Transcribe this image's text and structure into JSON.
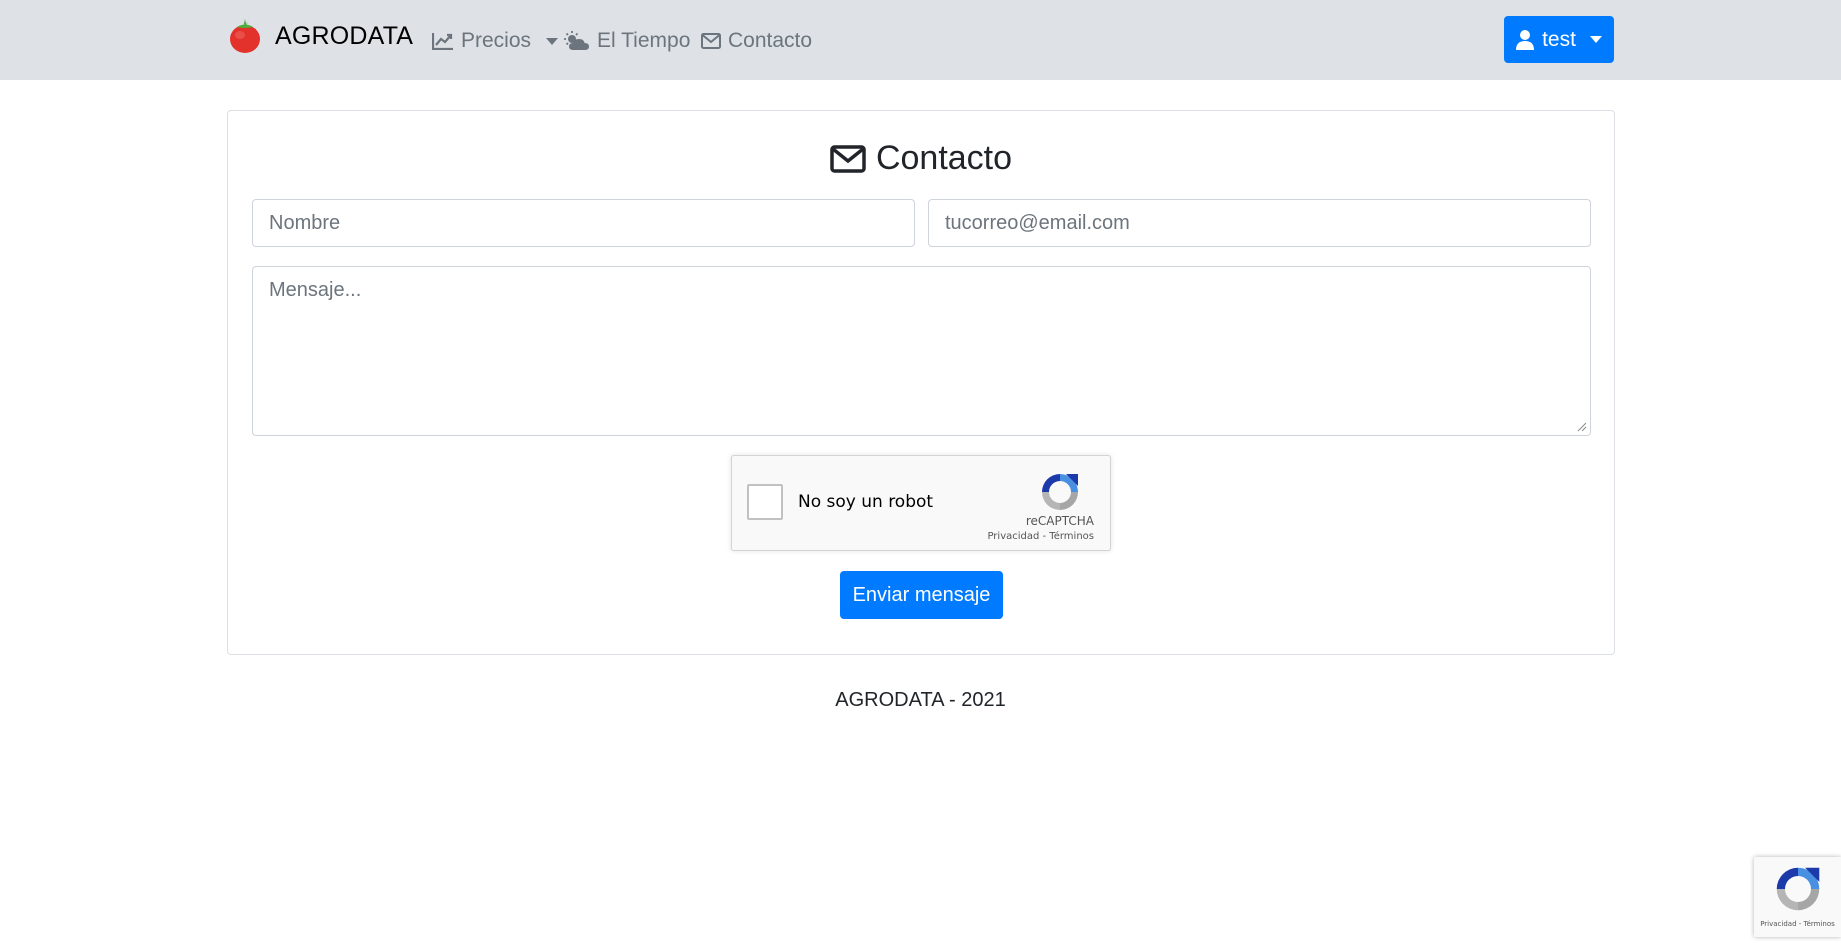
{
  "navbar": {
    "brand": "AGRODATA",
    "items": [
      {
        "label": "Precios",
        "icon": "chart-line-icon",
        "dropdown": true
      },
      {
        "label": "El Tiempo",
        "icon": "cloud-sun-icon",
        "dropdown": false
      },
      {
        "label": "Contacto",
        "icon": "envelope-icon",
        "dropdown": false
      }
    ],
    "user": {
      "label": "test",
      "icon": "user-icon"
    }
  },
  "contact": {
    "title": "Contacto",
    "name_placeholder": "Nombre",
    "email_placeholder": "tucorreo@email.com",
    "message_placeholder": "Mensaje...",
    "submit_label": "Enviar mensaje"
  },
  "recaptcha": {
    "label": "No soy un robot",
    "brand": "reCAPTCHA",
    "links": "Privacidad - Términos",
    "badge_links": "Privacidad - Términos"
  },
  "footer": {
    "text": "AGRODATA - 2021"
  },
  "colors": {
    "primary": "#007bff",
    "navbar_bg": "#dee2e6",
    "nav_text": "#6c757d"
  }
}
